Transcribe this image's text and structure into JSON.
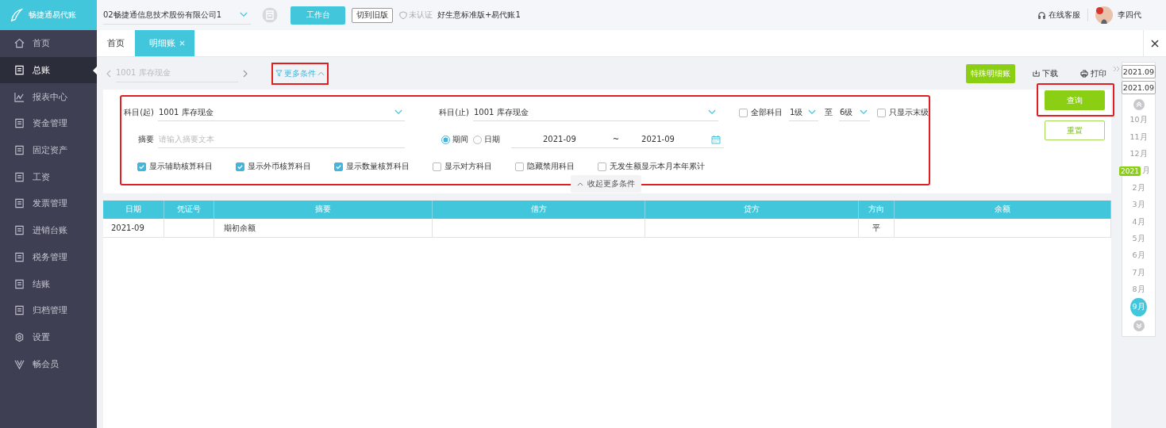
{
  "brand": {
    "name": "畅捷通易代账"
  },
  "sidebar": {
    "items": [
      {
        "label": "首页",
        "selected": false
      },
      {
        "label": "总账",
        "selected": true
      },
      {
        "label": "报表中心",
        "selected": false
      },
      {
        "label": "资金管理",
        "selected": false
      },
      {
        "label": "固定资产",
        "selected": false
      },
      {
        "label": "工资",
        "selected": false
      },
      {
        "label": "发票管理",
        "selected": false
      },
      {
        "label": "进销台账",
        "selected": false
      },
      {
        "label": "税务管理",
        "selected": false
      },
      {
        "label": "结账",
        "selected": false
      },
      {
        "label": "归档管理",
        "selected": false
      },
      {
        "label": "设置",
        "selected": false
      },
      {
        "label": "畅会员",
        "selected": false
      }
    ]
  },
  "topbar": {
    "company": "02畅捷通信息技术股份有限公司1",
    "workbench": "工作台",
    "old_version": "切到旧版",
    "auth_status": "未认证",
    "edition": "好生意标准版+易代账1",
    "support": "在线客服",
    "user": "李四代"
  },
  "tabs": [
    {
      "label": "首页",
      "selected": false,
      "closable": false
    },
    {
      "label": "明细账",
      "selected": true,
      "closable": true
    }
  ],
  "toolbar": {
    "account": "1001 库存现金",
    "more_conditions": {
      "label": "更多条件",
      "highlighted": true
    },
    "special_button": "特殊明细账",
    "download": "下载",
    "print": "打印"
  },
  "filters": {
    "highlighted": true,
    "subject_from": {
      "label": "科目(起)",
      "value": "1001 库存现金"
    },
    "subject_to": {
      "label": "科目(止)",
      "value": "1001 库存现金"
    },
    "all_subjects": {
      "label": "全部科目",
      "checked": false
    },
    "level_from": "1级",
    "level_sep": "至",
    "level_to": "6级",
    "leaf_only": {
      "label": "只显示末级",
      "checked": false
    },
    "summary": {
      "label": "摘要",
      "placeholder": "请输入摘要文本"
    },
    "modes": [
      {
        "label": "期间",
        "selected": true
      },
      {
        "label": "日期",
        "selected": false
      }
    ],
    "range_start": "2021-09",
    "range_sep": "~",
    "range_end": "2021-09",
    "options": [
      {
        "label": "显示辅助核算科目",
        "checked": true
      },
      {
        "label": "显示外币核算科目",
        "checked": true
      },
      {
        "label": "显示数量核算科目",
        "checked": true
      },
      {
        "label": "显示对方科目",
        "checked": false
      },
      {
        "label": "隐藏禁用科目",
        "checked": false
      },
      {
        "label": "无发生额显示本月本年累计",
        "checked": false
      }
    ],
    "collapse": "收起更多条件"
  },
  "actions": {
    "query": {
      "label": "查询",
      "highlighted": true
    },
    "reset": "重置"
  },
  "table": {
    "columns": [
      "日期",
      "凭证号",
      "摘要",
      "借方",
      "贷方",
      "方向",
      "余额"
    ],
    "rows": [
      [
        "2021-09",
        null,
        "期初余额",
        null,
        null,
        "平",
        null
      ]
    ]
  },
  "timeline": {
    "start": "2021.09",
    "end": "2021.09",
    "months": [
      {
        "label": "10月",
        "selected": false
      },
      {
        "label": "11月",
        "selected": false
      },
      {
        "label": "12月",
        "selected": false
      },
      {
        "label": "月",
        "year": "2021",
        "selected": false
      },
      {
        "label": "2月",
        "selected": false
      },
      {
        "label": "3月",
        "selected": false
      },
      {
        "label": "4月",
        "selected": false
      },
      {
        "label": "5月",
        "selected": false
      },
      {
        "label": "6月",
        "selected": false
      },
      {
        "label": "7月",
        "selected": false
      },
      {
        "label": "8月",
        "selected": false
      },
      {
        "label": "9月",
        "selected": true
      }
    ]
  }
}
